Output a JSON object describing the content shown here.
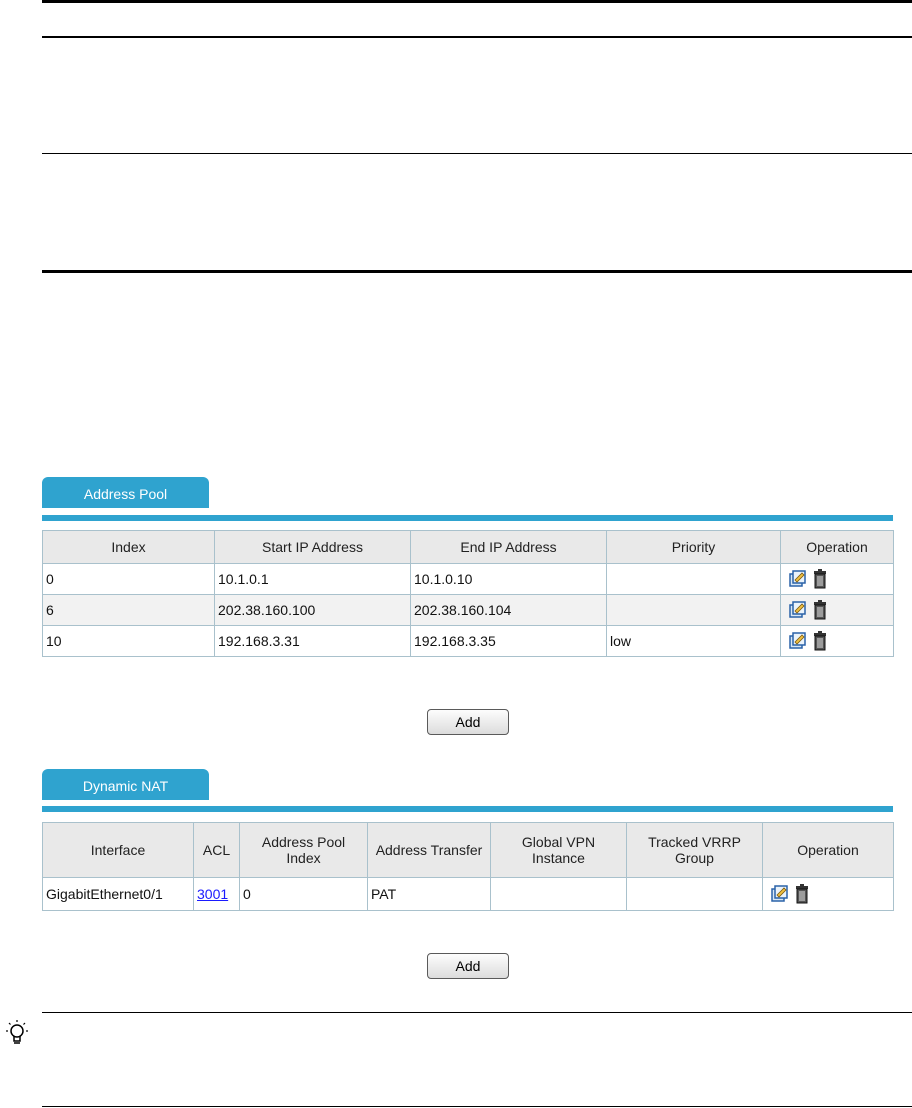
{
  "address_pool": {
    "tab_label": "Address Pool",
    "columns": [
      "Index",
      "Start IP Address",
      "End IP Address",
      "Priority",
      "Operation"
    ],
    "rows": [
      {
        "index": "0",
        "start_ip": "10.1.0.1",
        "end_ip": "10.1.0.10",
        "priority": ""
      },
      {
        "index": "6",
        "start_ip": "202.38.160.100",
        "end_ip": "202.38.160.104",
        "priority": ""
      },
      {
        "index": "10",
        "start_ip": "192.168.3.31",
        "end_ip": "192.168.3.35",
        "priority": "low"
      }
    ],
    "add_label": "Add"
  },
  "dynamic_nat": {
    "tab_label": "Dynamic NAT",
    "columns": [
      "Interface",
      "ACL",
      "Address Pool Index",
      "Address Transfer",
      "Global VPN Instance",
      "Tracked VRRP Group",
      "Operation"
    ],
    "rows": [
      {
        "interface": "GigabitEthernet0/1",
        "acl": "3001",
        "pool_index": "0",
        "transfer": "PAT",
        "vpn": "",
        "vrrp": ""
      }
    ],
    "add_label": "Add"
  },
  "icons": {
    "edit": "edit-icon",
    "delete": "delete-icon",
    "tip": "lightbulb-icon"
  },
  "colors": {
    "tab_blue": "#2fa3cf",
    "link": "#1a1aff"
  }
}
